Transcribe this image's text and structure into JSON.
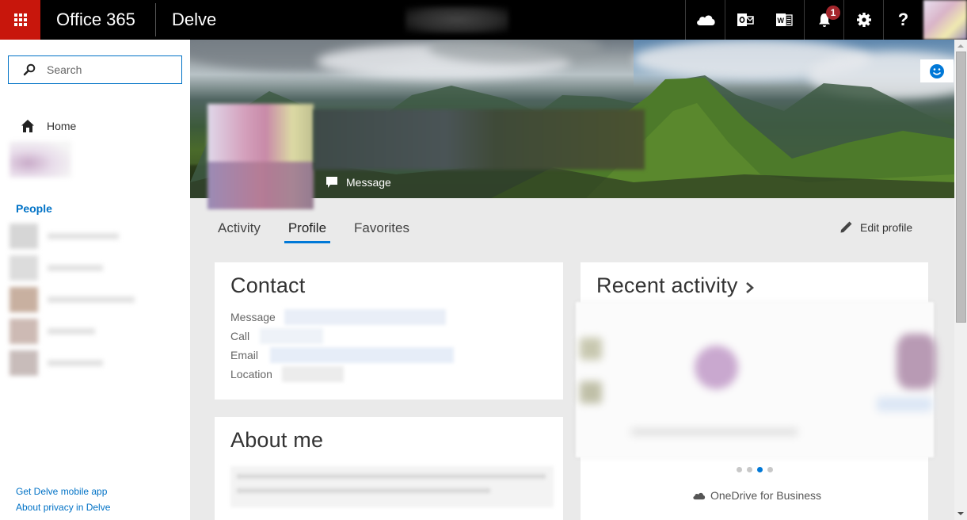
{
  "topbar": {
    "suite_name": "Office 365",
    "app_name": "Delve",
    "icons": [
      {
        "name": "onedrive-icon"
      },
      {
        "name": "outlook-icon"
      },
      {
        "name": "word-icon"
      },
      {
        "name": "notifications-icon",
        "badge": "1"
      },
      {
        "name": "settings-icon"
      },
      {
        "name": "help-icon",
        "glyph": "?"
      }
    ]
  },
  "sidebar": {
    "search_placeholder": "Search",
    "home_label": "Home",
    "people_label": "People",
    "footer_links": [
      "Get Delve mobile app",
      "About privacy in Delve"
    ]
  },
  "profile": {
    "message_label": "Message"
  },
  "tabs": [
    {
      "label": "Activity",
      "active": false
    },
    {
      "label": "Profile",
      "active": true
    },
    {
      "label": "Favorites",
      "active": false
    }
  ],
  "edit_profile_label": "Edit profile",
  "contact": {
    "title": "Contact",
    "rows": [
      {
        "label": "Message"
      },
      {
        "label": "Call"
      },
      {
        "label": "Email"
      },
      {
        "label": "Location"
      }
    ]
  },
  "about": {
    "title": "About me"
  },
  "recent_activity": {
    "title": "Recent activity",
    "carousel_pages": 4,
    "carousel_active_index": 2,
    "source_label": "OneDrive for Business"
  },
  "colors": {
    "accent": "#0078d7",
    "link": "#0072c6",
    "waffle": "#c8160c",
    "badge": "#a4262c"
  }
}
